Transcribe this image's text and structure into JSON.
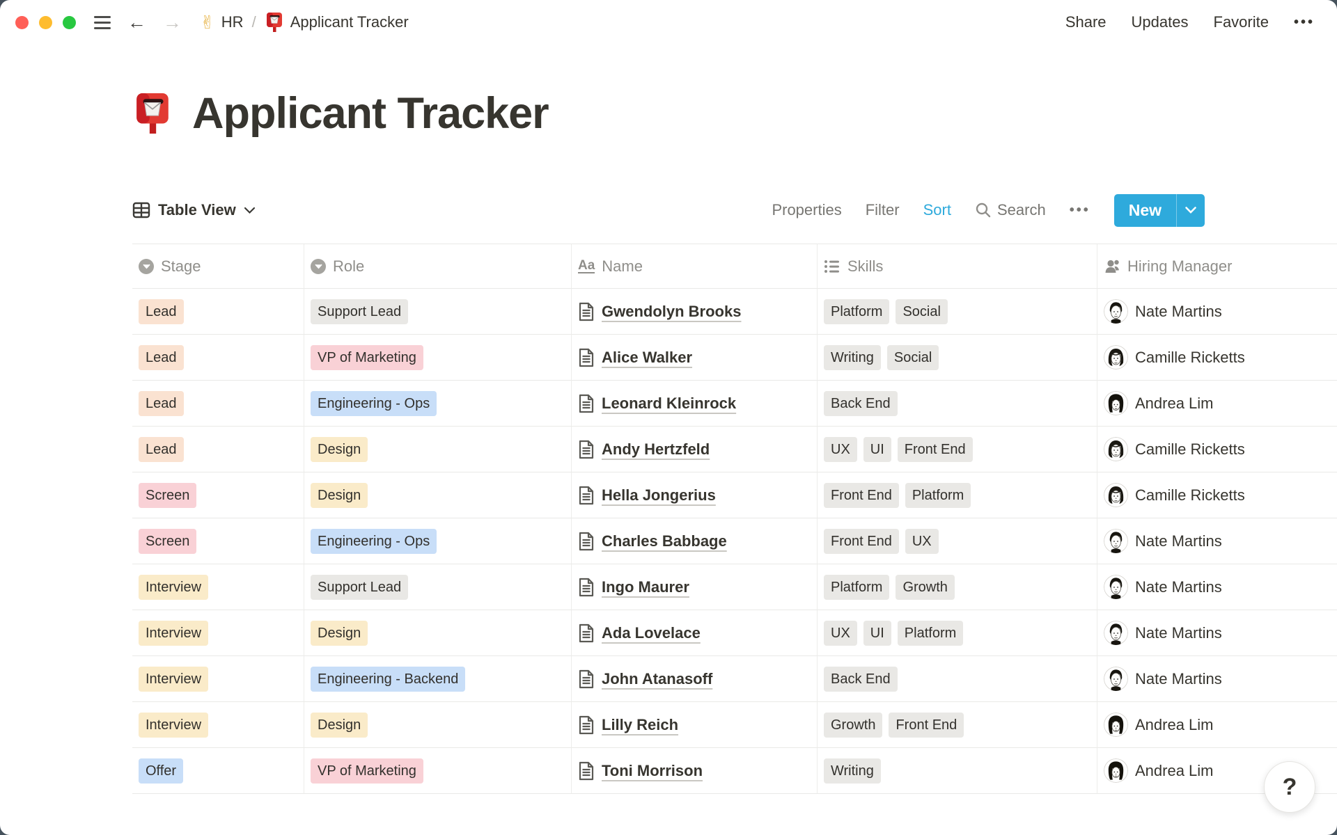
{
  "topbar": {
    "back": "←",
    "forward": "→",
    "breadcrumb": {
      "space_emoji": "✌",
      "space": "HR",
      "separator": "/",
      "page": "Applicant Tracker"
    },
    "actions": {
      "share": "Share",
      "updates": "Updates",
      "favorite": "Favorite",
      "more": "•••"
    }
  },
  "title": "Applicant Tracker",
  "toolbar": {
    "view": "Table View",
    "properties": "Properties",
    "filter": "Filter",
    "sort": "Sort",
    "search": "Search",
    "more": "•••",
    "new_label": "New"
  },
  "colors": {
    "accent_blue": "#2EAADC",
    "tag_orange": "#FAE2D1",
    "tag_pink": "#F9D1D6",
    "tag_yellow": "#FAEBC9",
    "tag_blue": "#C8DEF8",
    "tag_gray": "#E9E8E5"
  },
  "table": {
    "columns": [
      {
        "label": "Stage",
        "icon": "select"
      },
      {
        "label": "Role",
        "icon": "select"
      },
      {
        "label": "Name",
        "icon": "title"
      },
      {
        "label": "Skills",
        "icon": "list"
      },
      {
        "label": "Hiring Manager",
        "icon": "person"
      }
    ],
    "rows": [
      {
        "stage": {
          "label": "Lead",
          "color": "orange"
        },
        "role": {
          "label": "Support Lead",
          "color": "gray"
        },
        "name": "Gwendolyn Brooks",
        "skills": [
          "Platform",
          "Social"
        ],
        "manager": {
          "name": "Nate Martins",
          "avatar": "nate"
        }
      },
      {
        "stage": {
          "label": "Lead",
          "color": "orange"
        },
        "role": {
          "label": "VP of Marketing",
          "color": "pink"
        },
        "name": "Alice Walker",
        "skills": [
          "Writing",
          "Social"
        ],
        "manager": {
          "name": "Camille Ricketts",
          "avatar": "camille"
        }
      },
      {
        "stage": {
          "label": "Lead",
          "color": "orange"
        },
        "role": {
          "label": "Engineering - Ops",
          "color": "blue"
        },
        "name": "Leonard Kleinrock",
        "skills": [
          "Back End"
        ],
        "manager": {
          "name": "Andrea Lim",
          "avatar": "andrea"
        }
      },
      {
        "stage": {
          "label": "Lead",
          "color": "orange"
        },
        "role": {
          "label": "Design",
          "color": "yellow"
        },
        "name": "Andy Hertzfeld",
        "skills": [
          "UX",
          "UI",
          "Front End"
        ],
        "manager": {
          "name": "Camille Ricketts",
          "avatar": "camille"
        }
      },
      {
        "stage": {
          "label": "Screen",
          "color": "pink"
        },
        "role": {
          "label": "Design",
          "color": "yellow"
        },
        "name": "Hella Jongerius",
        "skills": [
          "Front End",
          "Platform"
        ],
        "manager": {
          "name": "Camille Ricketts",
          "avatar": "camille"
        }
      },
      {
        "stage": {
          "label": "Screen",
          "color": "pink"
        },
        "role": {
          "label": "Engineering - Ops",
          "color": "blue"
        },
        "name": "Charles Babbage",
        "skills": [
          "Front End",
          "UX"
        ],
        "manager": {
          "name": "Nate Martins",
          "avatar": "nate"
        }
      },
      {
        "stage": {
          "label": "Interview",
          "color": "yellow"
        },
        "role": {
          "label": "Support Lead",
          "color": "gray"
        },
        "name": "Ingo Maurer",
        "skills": [
          "Platform",
          "Growth"
        ],
        "manager": {
          "name": "Nate Martins",
          "avatar": "nate"
        }
      },
      {
        "stage": {
          "label": "Interview",
          "color": "yellow"
        },
        "role": {
          "label": "Design",
          "color": "yellow"
        },
        "name": "Ada Lovelace",
        "skills": [
          "UX",
          "UI",
          "Platform"
        ],
        "manager": {
          "name": "Nate Martins",
          "avatar": "nate"
        }
      },
      {
        "stage": {
          "label": "Interview",
          "color": "yellow"
        },
        "role": {
          "label": "Engineering - Backend",
          "color": "blue"
        },
        "name": "John Atanasoff",
        "skills": [
          "Back End"
        ],
        "manager": {
          "name": "Nate Martins",
          "avatar": "nate"
        }
      },
      {
        "stage": {
          "label": "Interview",
          "color": "yellow"
        },
        "role": {
          "label": "Design",
          "color": "yellow"
        },
        "name": "Lilly Reich",
        "skills": [
          "Growth",
          "Front End"
        ],
        "manager": {
          "name": "Andrea Lim",
          "avatar": "andrea"
        }
      },
      {
        "stage": {
          "label": "Offer",
          "color": "blue"
        },
        "role": {
          "label": "VP of Marketing",
          "color": "pink"
        },
        "name": "Toni Morrison",
        "skills": [
          "Writing"
        ],
        "manager": {
          "name": "Andrea Lim",
          "avatar": "andrea"
        }
      }
    ]
  },
  "help": {
    "label": "?"
  }
}
